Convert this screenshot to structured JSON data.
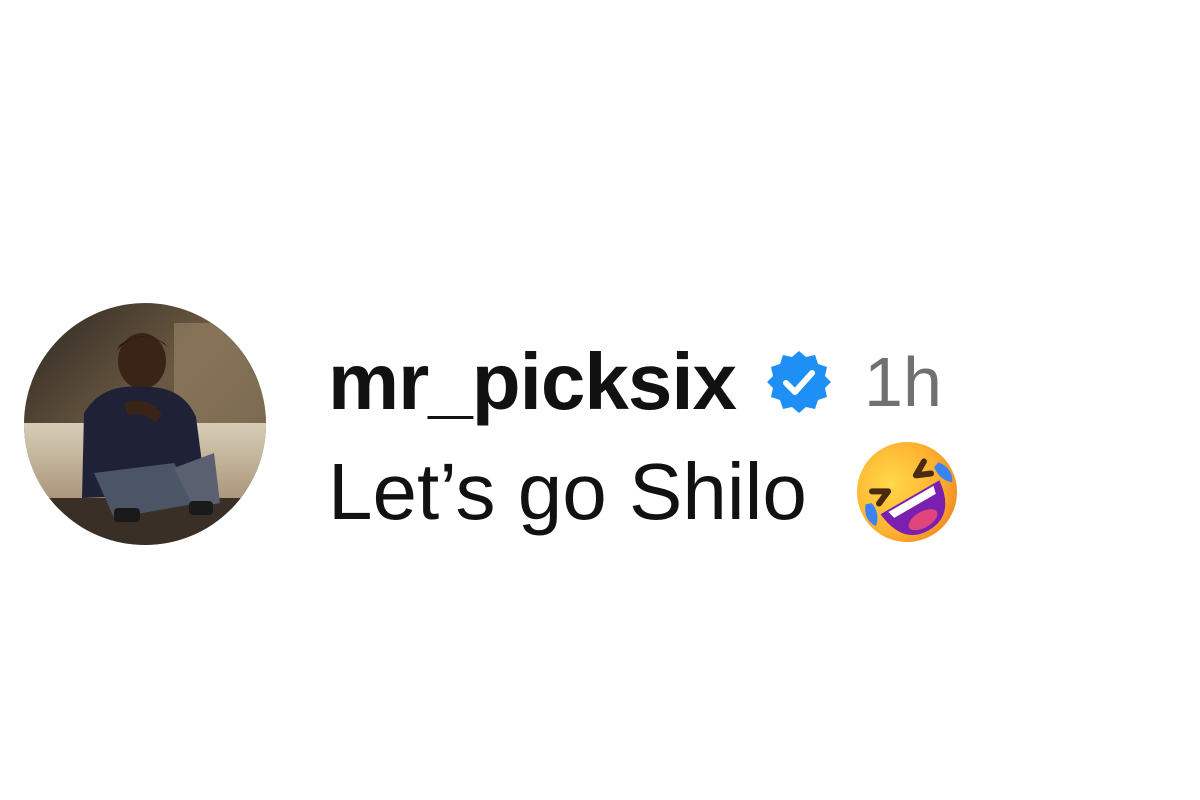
{
  "comment": {
    "username": "mr_picksix",
    "verified_icon": "verified-badge-icon",
    "timestamp": "1h",
    "text": "Let’s go Shilo",
    "emoji_icon": "rolling-on-floor-laughing-emoji"
  },
  "colors": {
    "verified_blue": "#1e8ff5",
    "username": "#111111",
    "timestamp": "#707070"
  }
}
